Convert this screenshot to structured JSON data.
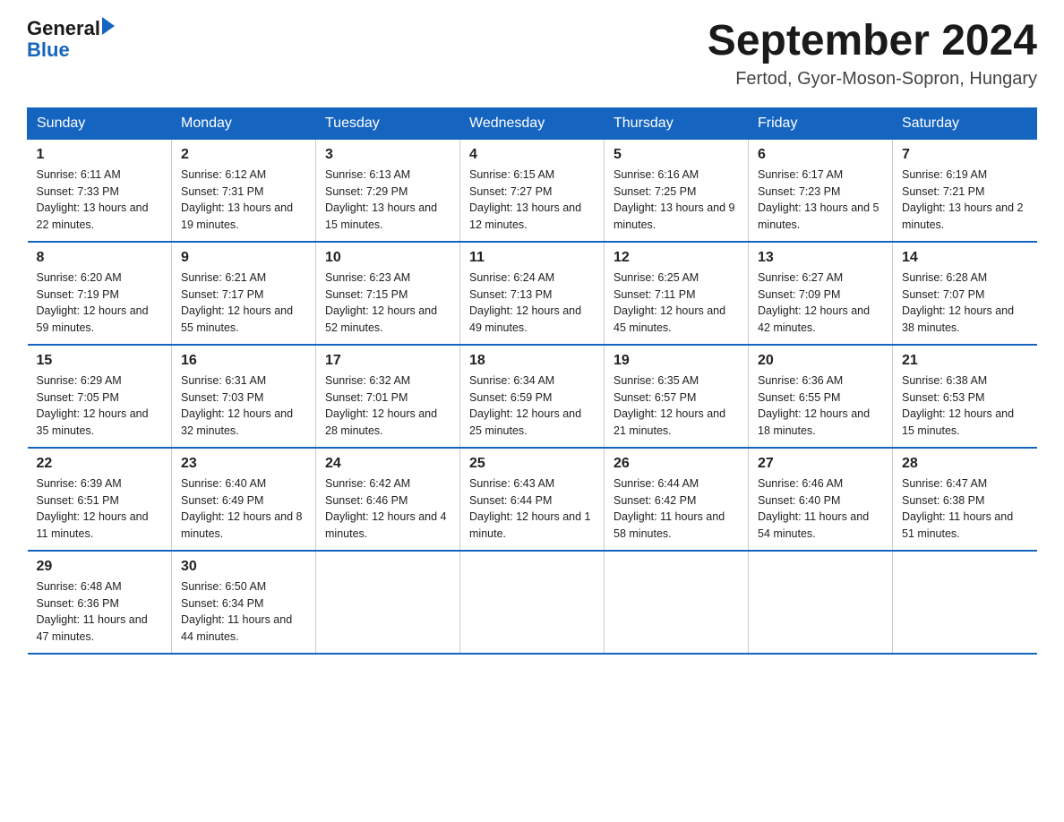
{
  "header": {
    "logo_general": "General",
    "logo_blue": "Blue",
    "title": "September 2024",
    "subtitle": "Fertod, Gyor-Moson-Sopron, Hungary"
  },
  "days_of_week": [
    "Sunday",
    "Monday",
    "Tuesday",
    "Wednesday",
    "Thursday",
    "Friday",
    "Saturday"
  ],
  "weeks": [
    [
      {
        "day": "1",
        "sunrise": "Sunrise: 6:11 AM",
        "sunset": "Sunset: 7:33 PM",
        "daylight": "Daylight: 13 hours and 22 minutes."
      },
      {
        "day": "2",
        "sunrise": "Sunrise: 6:12 AM",
        "sunset": "Sunset: 7:31 PM",
        "daylight": "Daylight: 13 hours and 19 minutes."
      },
      {
        "day": "3",
        "sunrise": "Sunrise: 6:13 AM",
        "sunset": "Sunset: 7:29 PM",
        "daylight": "Daylight: 13 hours and 15 minutes."
      },
      {
        "day": "4",
        "sunrise": "Sunrise: 6:15 AM",
        "sunset": "Sunset: 7:27 PM",
        "daylight": "Daylight: 13 hours and 12 minutes."
      },
      {
        "day": "5",
        "sunrise": "Sunrise: 6:16 AM",
        "sunset": "Sunset: 7:25 PM",
        "daylight": "Daylight: 13 hours and 9 minutes."
      },
      {
        "day": "6",
        "sunrise": "Sunrise: 6:17 AM",
        "sunset": "Sunset: 7:23 PM",
        "daylight": "Daylight: 13 hours and 5 minutes."
      },
      {
        "day": "7",
        "sunrise": "Sunrise: 6:19 AM",
        "sunset": "Sunset: 7:21 PM",
        "daylight": "Daylight: 13 hours and 2 minutes."
      }
    ],
    [
      {
        "day": "8",
        "sunrise": "Sunrise: 6:20 AM",
        "sunset": "Sunset: 7:19 PM",
        "daylight": "Daylight: 12 hours and 59 minutes."
      },
      {
        "day": "9",
        "sunrise": "Sunrise: 6:21 AM",
        "sunset": "Sunset: 7:17 PM",
        "daylight": "Daylight: 12 hours and 55 minutes."
      },
      {
        "day": "10",
        "sunrise": "Sunrise: 6:23 AM",
        "sunset": "Sunset: 7:15 PM",
        "daylight": "Daylight: 12 hours and 52 minutes."
      },
      {
        "day": "11",
        "sunrise": "Sunrise: 6:24 AM",
        "sunset": "Sunset: 7:13 PM",
        "daylight": "Daylight: 12 hours and 49 minutes."
      },
      {
        "day": "12",
        "sunrise": "Sunrise: 6:25 AM",
        "sunset": "Sunset: 7:11 PM",
        "daylight": "Daylight: 12 hours and 45 minutes."
      },
      {
        "day": "13",
        "sunrise": "Sunrise: 6:27 AM",
        "sunset": "Sunset: 7:09 PM",
        "daylight": "Daylight: 12 hours and 42 minutes."
      },
      {
        "day": "14",
        "sunrise": "Sunrise: 6:28 AM",
        "sunset": "Sunset: 7:07 PM",
        "daylight": "Daylight: 12 hours and 38 minutes."
      }
    ],
    [
      {
        "day": "15",
        "sunrise": "Sunrise: 6:29 AM",
        "sunset": "Sunset: 7:05 PM",
        "daylight": "Daylight: 12 hours and 35 minutes."
      },
      {
        "day": "16",
        "sunrise": "Sunrise: 6:31 AM",
        "sunset": "Sunset: 7:03 PM",
        "daylight": "Daylight: 12 hours and 32 minutes."
      },
      {
        "day": "17",
        "sunrise": "Sunrise: 6:32 AM",
        "sunset": "Sunset: 7:01 PM",
        "daylight": "Daylight: 12 hours and 28 minutes."
      },
      {
        "day": "18",
        "sunrise": "Sunrise: 6:34 AM",
        "sunset": "Sunset: 6:59 PM",
        "daylight": "Daylight: 12 hours and 25 minutes."
      },
      {
        "day": "19",
        "sunrise": "Sunrise: 6:35 AM",
        "sunset": "Sunset: 6:57 PM",
        "daylight": "Daylight: 12 hours and 21 minutes."
      },
      {
        "day": "20",
        "sunrise": "Sunrise: 6:36 AM",
        "sunset": "Sunset: 6:55 PM",
        "daylight": "Daylight: 12 hours and 18 minutes."
      },
      {
        "day": "21",
        "sunrise": "Sunrise: 6:38 AM",
        "sunset": "Sunset: 6:53 PM",
        "daylight": "Daylight: 12 hours and 15 minutes."
      }
    ],
    [
      {
        "day": "22",
        "sunrise": "Sunrise: 6:39 AM",
        "sunset": "Sunset: 6:51 PM",
        "daylight": "Daylight: 12 hours and 11 minutes."
      },
      {
        "day": "23",
        "sunrise": "Sunrise: 6:40 AM",
        "sunset": "Sunset: 6:49 PM",
        "daylight": "Daylight: 12 hours and 8 minutes."
      },
      {
        "day": "24",
        "sunrise": "Sunrise: 6:42 AM",
        "sunset": "Sunset: 6:46 PM",
        "daylight": "Daylight: 12 hours and 4 minutes."
      },
      {
        "day": "25",
        "sunrise": "Sunrise: 6:43 AM",
        "sunset": "Sunset: 6:44 PM",
        "daylight": "Daylight: 12 hours and 1 minute."
      },
      {
        "day": "26",
        "sunrise": "Sunrise: 6:44 AM",
        "sunset": "Sunset: 6:42 PM",
        "daylight": "Daylight: 11 hours and 58 minutes."
      },
      {
        "day": "27",
        "sunrise": "Sunrise: 6:46 AM",
        "sunset": "Sunset: 6:40 PM",
        "daylight": "Daylight: 11 hours and 54 minutes."
      },
      {
        "day": "28",
        "sunrise": "Sunrise: 6:47 AM",
        "sunset": "Sunset: 6:38 PM",
        "daylight": "Daylight: 11 hours and 51 minutes."
      }
    ],
    [
      {
        "day": "29",
        "sunrise": "Sunrise: 6:48 AM",
        "sunset": "Sunset: 6:36 PM",
        "daylight": "Daylight: 11 hours and 47 minutes."
      },
      {
        "day": "30",
        "sunrise": "Sunrise: 6:50 AM",
        "sunset": "Sunset: 6:34 PM",
        "daylight": "Daylight: 11 hours and 44 minutes."
      },
      null,
      null,
      null,
      null,
      null
    ]
  ]
}
